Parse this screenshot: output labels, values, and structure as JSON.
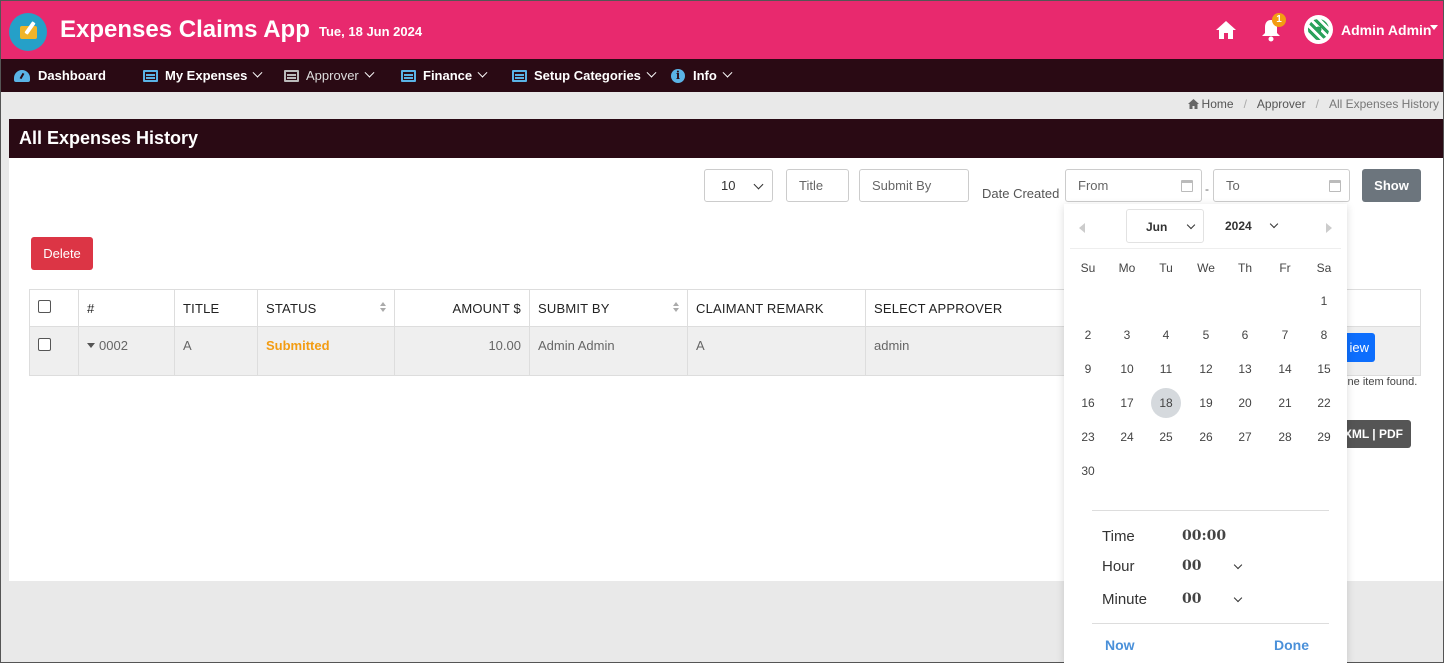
{
  "header": {
    "app_title": "Expenses Claims App",
    "date": "Tue, 18 Jun 2024",
    "notification_count": "1",
    "user_name": "Admin Admin"
  },
  "nav": {
    "dashboard": "Dashboard",
    "my_expenses": "My Expenses",
    "approver": "Approver",
    "finance": "Finance",
    "setup_categories": "Setup Categories",
    "info": "Info",
    "info_glyph": "i"
  },
  "breadcrumb": {
    "home": "Home",
    "sep1": "/",
    "approver": "Approver",
    "sep2": "/",
    "current": "All Expenses History"
  },
  "page": {
    "title": "All Expenses History"
  },
  "filters": {
    "per_page": "10",
    "title_placeholder": "Title",
    "submit_by_placeholder": "Submit By",
    "date_created_label": "Date Created",
    "from_placeholder": "From",
    "to_placeholder": "To",
    "dash": "-",
    "show_button": "Show"
  },
  "actions": {
    "delete_button": "Delete",
    "view_button": "iew",
    "found_text": "One item found.",
    "export_text": "XML  |  PDF"
  },
  "table": {
    "headers": [
      "#",
      "TITLE",
      "STATUS",
      "AMOUNT $",
      "SUBMIT BY",
      "CLAIMANT REMARK",
      "SELECT APPROVER"
    ],
    "rows": [
      {
        "id": "0002",
        "title": "A",
        "status": "Submitted",
        "amount": "10.00",
        "submit_by": "Admin Admin",
        "remark": "A",
        "approver": "admin"
      }
    ]
  },
  "datepicker": {
    "month": "Jun",
    "year": "2024",
    "weekdays": [
      "Su",
      "Mo",
      "Tu",
      "We",
      "Th",
      "Fr",
      "Sa"
    ],
    "selected_day": 18,
    "time_label": "Time",
    "time_value": "00:00",
    "hour_label": "Hour",
    "hour_value": "00",
    "minute_label": "Minute",
    "minute_value": "00",
    "now_button": "Now",
    "done_button": "Done"
  },
  "colors": {
    "header_bg": "#e8296e",
    "nav_bg": "#2a0a14",
    "status_submitted": "#f39c12",
    "delete": "#dc3545",
    "primary": "#0d6efd",
    "link": "#4a90d9"
  }
}
